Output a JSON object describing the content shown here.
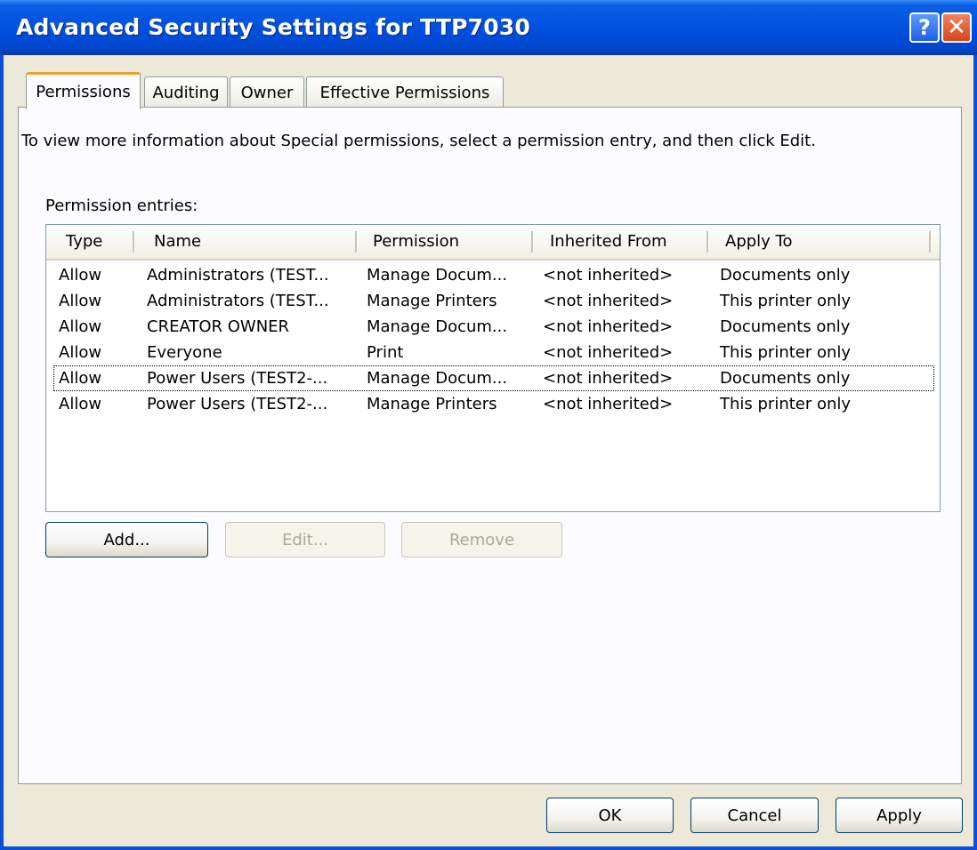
{
  "window": {
    "title": "Advanced Security Settings for TTP7030"
  },
  "titlebar_buttons": {
    "help": "?",
    "close": "✕"
  },
  "tabs": [
    {
      "label": "Permissions",
      "active": true
    },
    {
      "label": "Auditing",
      "active": false
    },
    {
      "label": "Owner",
      "active": false
    },
    {
      "label": "Effective Permissions",
      "active": false
    }
  ],
  "info_text": "To view more information about Special permissions, select a permission entry, and then click Edit.",
  "entries_label": "Permission entries:",
  "columns": [
    "Type",
    "Name",
    "Permission",
    "Inherited From",
    "Apply To"
  ],
  "rows": [
    [
      "Allow",
      "Administrators (TEST...",
      "Manage Docum...",
      "<not inherited>",
      "Documents only"
    ],
    [
      "Allow",
      "Administrators (TEST...",
      "Manage Printers",
      "<not inherited>",
      "This printer only"
    ],
    [
      "Allow",
      "CREATOR OWNER",
      "Manage Docum...",
      "<not inherited>",
      "Documents only"
    ],
    [
      "Allow",
      "Everyone",
      "Print",
      "<not inherited>",
      "This printer only"
    ],
    [
      "Allow",
      "Power Users (TEST2-...",
      "Manage Docum...",
      "<not inherited>",
      "Documents only"
    ],
    [
      "Allow",
      "Power Users (TEST2-...",
      "Manage Printers",
      "<not inherited>",
      "This printer only"
    ]
  ],
  "focused_row": 4,
  "buttons": {
    "add": "Add...",
    "edit": "Edit...",
    "remove": "Remove",
    "ok": "OK",
    "cancel": "Cancel",
    "apply": "Apply"
  },
  "colors": {
    "titlebar": "#0050E0",
    "dialog_bg": "#ECE9D8",
    "active_tab_accent": "#F0A030",
    "close_button": "#D9431B",
    "disabled_text": "#ACA899"
  }
}
